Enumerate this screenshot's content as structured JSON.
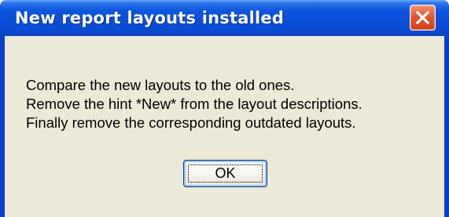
{
  "dialog": {
    "title": "New report layouts installed",
    "close_icon": "close-icon",
    "message_lines": [
      "Compare the new layouts to the old ones.",
      "Remove the hint *New* from the layout descriptions.",
      "Finally remove the corresponding outdated layouts."
    ],
    "ok_label": "OK"
  },
  "colors": {
    "titlebar": "#0a4fd8",
    "close_button": "#e2582f",
    "dialog_face": "#ece9d8",
    "button_border": "#003c74"
  }
}
